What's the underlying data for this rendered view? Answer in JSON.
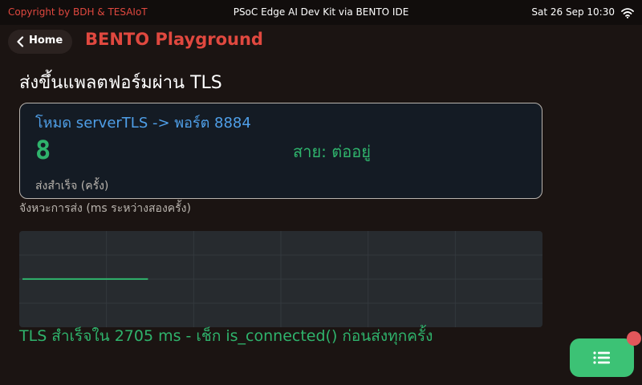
{
  "topbar": {
    "copyright": "Copyright by BDH & TESAIoT",
    "device": "PSoC Edge AI Dev Kit via BENTO IDE",
    "datetime": "Sat 26 Sep 10:30",
    "wifi_icon": "wifi-icon"
  },
  "nav": {
    "home_label": "Home",
    "app_title": "BENTO Playground"
  },
  "page": {
    "title": "ส่งขึ้นแพลตฟอร์มผ่าน TLS"
  },
  "card": {
    "mode_text": "โหมด serverTLS -> พอร์ต 8884",
    "success_count": "8",
    "status_text": "สาย: ต่ออยู่",
    "caption": "ส่งสำเร็จ (ครั้ง)"
  },
  "interval": {
    "label": "จังหวะการส่ง (ms ระหว่างสองครั้ง)"
  },
  "chart_data": {
    "type": "line",
    "title": "",
    "xlabel": "",
    "ylabel": "",
    "grid": true,
    "grid_cols": 6,
    "grid_rows": 4,
    "x_points": 30,
    "series": [
      {
        "values": [
          2705,
          2705,
          2705,
          2705,
          2705,
          2705,
          2705,
          2705
        ],
        "color": "#2fb36c"
      }
    ],
    "ylim": [
      0,
      5400
    ]
  },
  "result": {
    "message": "TLS สำเร็จใน 2705 ms - เช็ก is_connected() ก่อนส่งทุกครั้ง"
  },
  "fab": {
    "icon": "list-icon",
    "color": "#3cc275",
    "badge_color": "#e2575b"
  },
  "colors": {
    "accent_red": "#e0483f",
    "accent_blue": "#4f9fe8",
    "accent_green": "#2fb36c",
    "background": "#1b1412"
  }
}
